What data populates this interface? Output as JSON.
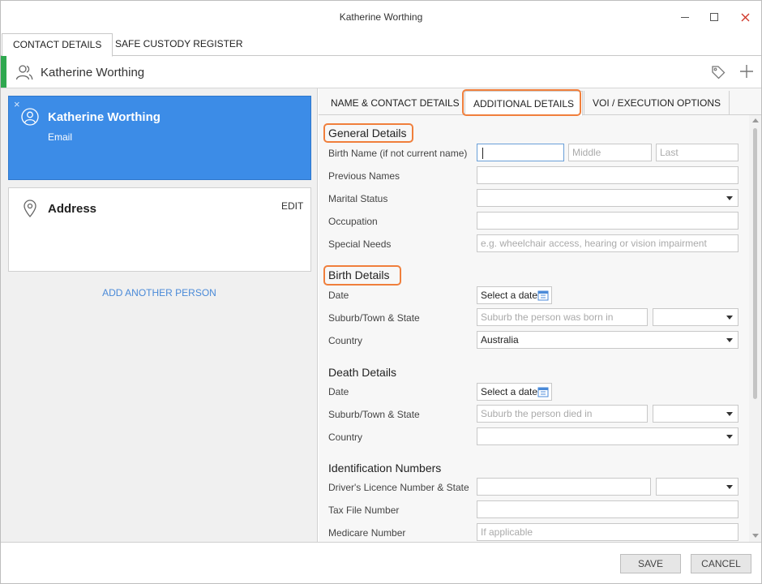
{
  "window": {
    "title": "Katherine Worthing"
  },
  "main_tabs": [
    {
      "label": "CONTACT DETAILS"
    },
    {
      "label": "SAFE CUSTODY REGISTER"
    }
  ],
  "header": {
    "name": "Katherine Worthing"
  },
  "left": {
    "person_card": {
      "name": "Katherine Worthing",
      "subtitle": "Email",
      "close_glyph": "×"
    },
    "address_card": {
      "title": "Address",
      "edit_label": "EDIT"
    },
    "add_person_label": "ADD ANOTHER PERSON"
  },
  "sub_tabs": [
    {
      "label": "NAME & CONTACT DETAILS"
    },
    {
      "label": "ADDITIONAL DETAILS"
    },
    {
      "label": "VOI / EXECUTION OPTIONS"
    }
  ],
  "general": {
    "title": "General Details",
    "birth_name_label": "Birth Name (if not current name)",
    "middle_placeholder": "Middle",
    "last_placeholder": "Last",
    "previous_names_label": "Previous Names",
    "marital_status_label": "Marital Status",
    "occupation_label": "Occupation",
    "special_needs_label": "Special Needs",
    "special_needs_placeholder": "e.g. wheelchair access, hearing or vision impairment"
  },
  "birth": {
    "title": "Birth Details",
    "date_label": "Date",
    "date_button": "Select a date",
    "suburb_label": "Suburb/Town & State",
    "suburb_placeholder": "Suburb the person was born in",
    "country_label": "Country",
    "country_value": "Australia"
  },
  "death": {
    "title": "Death Details",
    "date_label": "Date",
    "date_button": "Select a date",
    "suburb_label": "Suburb/Town & State",
    "suburb_placeholder": "Suburb the person died in",
    "country_label": "Country"
  },
  "identification": {
    "title": "Identification Numbers",
    "licence_label": "Driver's Licence Number & State",
    "tfn_label": "Tax File Number",
    "medicare_label": "Medicare Number",
    "medicare_placeholder": "If applicable"
  },
  "footer": {
    "save_label": "SAVE",
    "cancel_label": "CANCEL"
  },
  "colors": {
    "accent_green": "#2fa84f",
    "card_blue": "#3c8ce7",
    "highlight_orange": "#f07f3c",
    "link_blue": "#4a8ad8"
  }
}
